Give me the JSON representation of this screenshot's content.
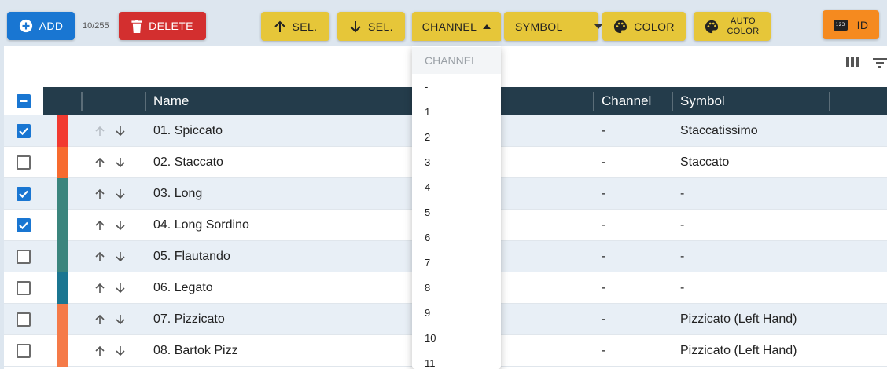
{
  "toolbar": {
    "add_label": "ADD",
    "counter": "10/255",
    "delete_label": "DELETE",
    "sel_up_label": "SEL.",
    "sel_down_label": "SEL.",
    "channel_label": "CHANNEL",
    "symbol_label": "SYMBOL",
    "color_label": "COLOR",
    "auto_color_line1": "AUTO",
    "auto_color_line2": "COLOR",
    "id_label": "ID",
    "id_icon_text": "123"
  },
  "table": {
    "headers": {
      "name": "Name",
      "channel": "Channel",
      "symbol": "Symbol"
    },
    "rows": [
      {
        "name": "01. Spiccato",
        "channel": "-",
        "symbol": "Staccatissimo",
        "checked": true,
        "color": "#f23a30",
        "up_disabled": true
      },
      {
        "name": "02. Staccato",
        "channel": "-",
        "symbol": "Staccato",
        "checked": false,
        "color": "#f76b2f",
        "up_disabled": false
      },
      {
        "name": "03. Long",
        "channel": "-",
        "symbol": "-",
        "checked": true,
        "color": "#3b857d",
        "up_disabled": false
      },
      {
        "name": "04. Long Sordino",
        "channel": "-",
        "symbol": "-",
        "checked": true,
        "color": "#3b857d",
        "up_disabled": false
      },
      {
        "name": "05. Flautando",
        "channel": "-",
        "symbol": "-",
        "checked": false,
        "color": "#3b857d",
        "up_disabled": false
      },
      {
        "name": "06. Legato",
        "channel": "-",
        "symbol": "-",
        "checked": false,
        "color": "#1b7691",
        "up_disabled": false
      },
      {
        "name": "07. Pizzicato",
        "channel": "-",
        "symbol": "Pizzicato (Left Hand)",
        "checked": false,
        "color": "#f57a48",
        "up_disabled": false
      },
      {
        "name": "08. Bartok Pizz",
        "channel": "-",
        "symbol": "Pizzicato (Left Hand)",
        "checked": false,
        "color": "#f57a48",
        "up_disabled": false
      }
    ]
  },
  "channel_dropdown": {
    "header": "CHANNEL",
    "options": [
      "-",
      "1",
      "2",
      "3",
      "4",
      "5",
      "6",
      "7",
      "8",
      "9",
      "10",
      "11"
    ]
  },
  "icons": {
    "add": "plus-circle-icon",
    "delete": "trash-icon",
    "sel_up": "arrow-up-icon",
    "sel_down": "arrow-down-icon",
    "channel_caret": "caret-up-icon",
    "symbol_caret": "caret-down-icon",
    "color": "palette-icon",
    "auto_color": "palette-icon",
    "id": "numeric-badge-icon",
    "columns": "view-column-icon",
    "filter": "filter-icon"
  }
}
